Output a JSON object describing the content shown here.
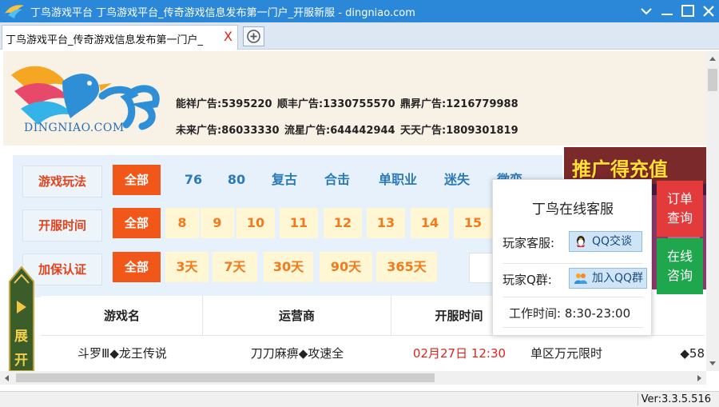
{
  "window": {
    "title": "丁鸟游戏平台 丁鸟游戏平台_传奇游戏信息发布第一门户_开服新服 - dingniao.com"
  },
  "tab": {
    "label": "丁鸟游戏平台_传奇游戏信息发布第一门户_",
    "close": "X"
  },
  "brand": {
    "url": "DINGNIAO.COM"
  },
  "ads": {
    "row1": [
      "能祥广告:5395220",
      "顺丰广告:1330755570",
      "鼎昇广告:1216779988"
    ],
    "row2": [
      "未来广告:86033330",
      "流星广告:644442944",
      "天天广告:1809301819"
    ]
  },
  "filters": {
    "game_type": {
      "label": "游戏玩法",
      "all": "全部",
      "options": [
        "76",
        "80",
        "复古",
        "合击",
        "单职业",
        "迷失",
        "微变"
      ]
    },
    "open_time": {
      "label": "开服时间",
      "all": "全部",
      "options": [
        "8",
        "9",
        "10",
        "11",
        "12",
        "13",
        "14",
        "15"
      ]
    },
    "guarantee": {
      "label": "加保认证",
      "all": "全部",
      "options": [
        "3天",
        "7天",
        "30天",
        "90天",
        "365天"
      ]
    }
  },
  "table": {
    "headers": [
      "游戏名",
      "运营商",
      "开服时间"
    ],
    "row": {
      "name": "斗罗Ⅲ◆龙王传说",
      "operator": "刀刀麻痹◆攻速全",
      "time": "02月27日 12:30",
      "feature": "单区万元限时",
      "extra": "◆58"
    }
  },
  "side_expand": {
    "chars": [
      "展",
      "开"
    ]
  },
  "promo": {
    "text": "推广得充值"
  },
  "support": {
    "title": "丁鸟在线客服",
    "player_service_label": "玩家客服:",
    "qq_chat": "QQ交谈",
    "player_group_label": "玩家Q群:",
    "qq_group": "加入QQ群",
    "work_hours": "工作时间: 8:30-23:00"
  },
  "side_buttons": {
    "order": [
      "订单",
      "查询"
    ],
    "online": [
      "在线",
      "咨询"
    ]
  },
  "status": {
    "version": "Ver:3.3.5.516"
  },
  "colors": {
    "titlebar": "#2b88d8",
    "accent_orange": "#f2571a",
    "link_blue": "#2a7ab8",
    "side_red": "#e33b3b",
    "side_green": "#1fa74d"
  }
}
